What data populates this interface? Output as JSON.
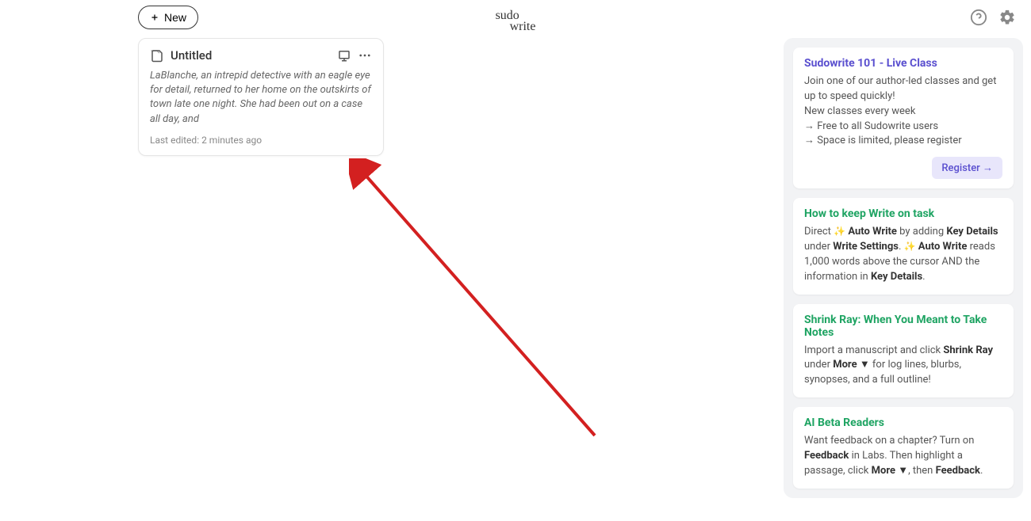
{
  "header": {
    "new_button_label": "New",
    "logo_line1": "sudo",
    "logo_line2": "write"
  },
  "doc_card": {
    "title": "Untitled",
    "preview": "LaBlanche, an intrepid detective with an eagle eye for detail, returned to her home on the outskirts of town late one night. She had been out on a case all day, and",
    "last_edited": "Last edited: 2 minutes ago"
  },
  "sidebar": {
    "card1": {
      "title": "Sudowrite 101 - Live Class",
      "line1": "Join one of our author-led classes and get up to speed quickly!",
      "line2": "New classes every week",
      "line3": "→ Free to all Sudowrite users",
      "line4": "→ Space is limited, please register",
      "button": "Register →"
    },
    "card2": {
      "title": "How to keep Write on task",
      "pre": "Direct ",
      "autowrite": "Auto Write",
      "mid1": " by adding ",
      "keydetails": "Key Details",
      "mid2": " under ",
      "writesettings": "Write Settings",
      "mid3": ". ",
      "mid4": " reads 1,000 words above the cursor AND the information in ",
      "end": "."
    },
    "card3": {
      "title": "Shrink Ray: When You Meant to Take Notes",
      "pre": "Import a manuscript and click ",
      "shrinkray": "Shrink Ray",
      "mid1": " under ",
      "more": "More ▼",
      "end": " for log lines, blurbs, synopses, and a full outline!"
    },
    "card4": {
      "title": "AI Beta Readers",
      "pre": "Want feedback on a chapter? Turn on ",
      "feedback": "Feedback",
      "mid1": " in Labs. Then highlight a passage, click ",
      "more": "More ▼",
      "mid2": ", then ",
      "end": "."
    }
  }
}
